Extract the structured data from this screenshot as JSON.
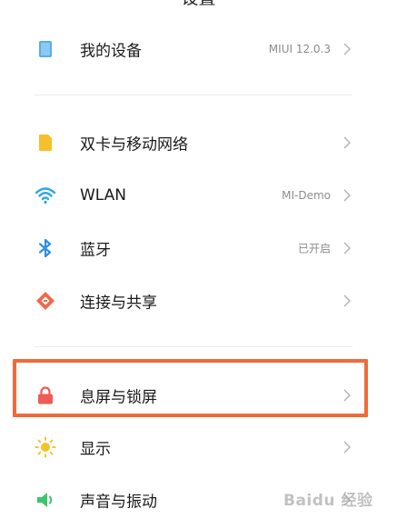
{
  "header": {
    "title": "设置"
  },
  "settings": [
    {
      "label": "我的设备",
      "value": "MIUI 12.0.3",
      "icon": "device-icon"
    },
    {
      "label": "双卡与移动网络",
      "value": "",
      "icon": "sim-card-icon"
    },
    {
      "label": "WLAN",
      "value": "MI-Demo",
      "icon": "wifi-icon"
    },
    {
      "label": "蓝牙",
      "value": "已开启",
      "icon": "bluetooth-icon"
    },
    {
      "label": "连接与共享",
      "value": "",
      "icon": "connection-share-icon"
    },
    {
      "label": "息屏与锁屏",
      "value": "",
      "icon": "lock-icon"
    },
    {
      "label": "显示",
      "value": "",
      "icon": "brightness-icon"
    },
    {
      "label": "声音与振动",
      "value": "",
      "icon": "speaker-icon"
    }
  ],
  "annotation": {
    "highlighted_item": "息屏与锁屏",
    "color": "#f06a3a"
  },
  "watermark": {
    "text": "Baidu 经验"
  },
  "colors": {
    "device": "#5aaee8",
    "sim": "#f5c02c",
    "wifi": "#2aa7e8",
    "bluetooth": "#2f8fe0",
    "share": "#ee6a4c",
    "lock": "#ef5b55",
    "brightness": "#f7c229",
    "sound": "#3ec46a"
  }
}
